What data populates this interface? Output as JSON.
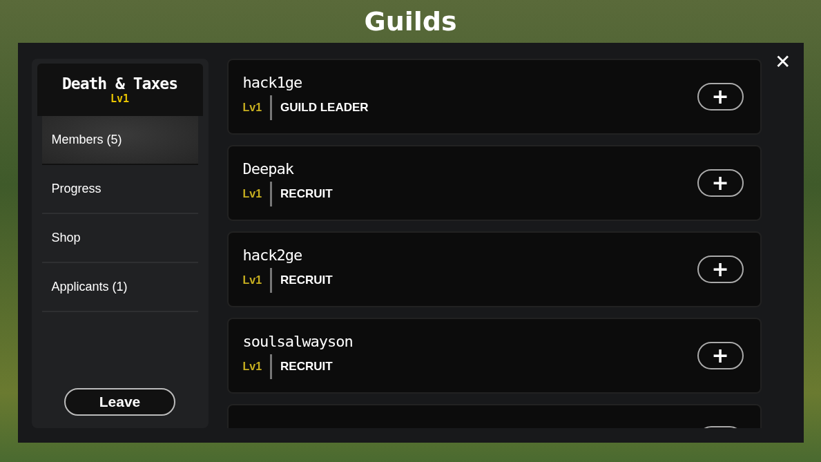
{
  "title": "Guilds",
  "guild": {
    "name": "Death & Taxes",
    "level": "Lv1"
  },
  "sidebar": {
    "items": [
      {
        "label": "Members (5)",
        "selected": true
      },
      {
        "label": "Progress",
        "selected": false
      },
      {
        "label": "Shop",
        "selected": false
      },
      {
        "label": "Applicants (1)",
        "selected": false
      }
    ],
    "leave_button": "Leave"
  },
  "close_button": "✕",
  "members": [
    {
      "name": "hack1ge",
      "level": "Lv1",
      "rank": "GUILD LEADER",
      "action": "+"
    },
    {
      "name": "Deepak",
      "level": "Lv1",
      "rank": "RECRUIT",
      "action": "+"
    },
    {
      "name": "hack2ge",
      "level": "Lv1",
      "rank": "RECRUIT",
      "action": "+"
    },
    {
      "name": "soulsalwayson",
      "level": "Lv1",
      "rank": "RECRUIT",
      "action": "+"
    }
  ]
}
